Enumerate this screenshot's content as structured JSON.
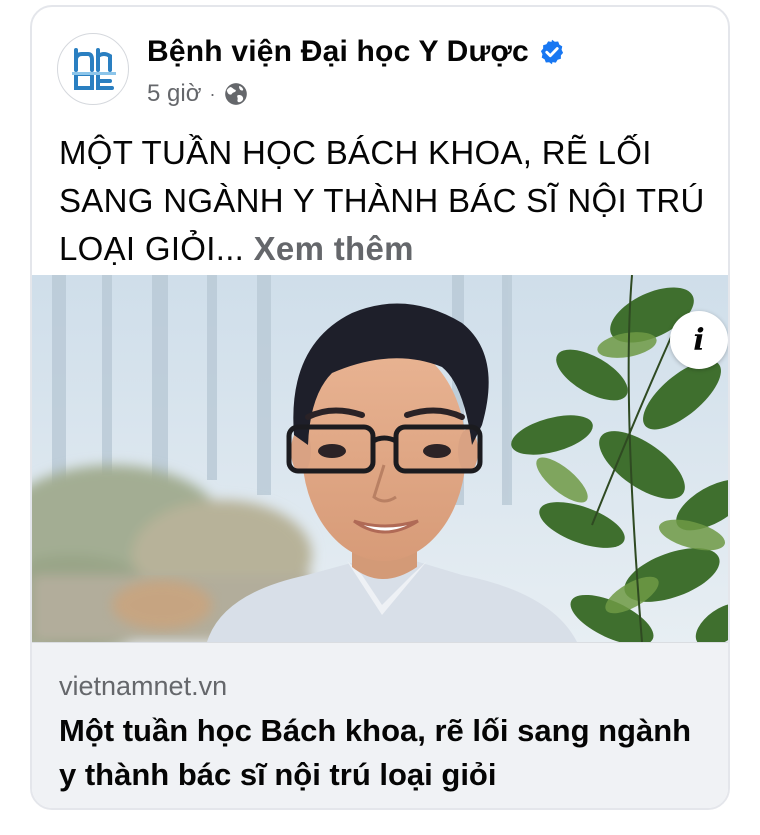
{
  "post": {
    "page_name": "Bệnh viện Đại học Y Dược",
    "time_ago": "5 giờ",
    "separator": "·",
    "text": "MỘT TUẦN HỌC BÁCH KHOA, RẼ LỐI SANG NGÀNH Y THÀNH BÁC SĨ NỘI TRÚ LOẠI GIỎI...",
    "see_more": "Xem thêm"
  },
  "link_preview": {
    "domain": "vietnamnet.vn",
    "title": "Một tuần học Bách khoa, rẽ lối sang ngành y thành bác sĩ nội trú loại giỏi"
  },
  "icons": {
    "verified": "verified-badge-icon",
    "audience": "globe-icon",
    "info": "info-icon",
    "avatar": "hospital-logo"
  },
  "colors": {
    "text_primary": "#050505",
    "text_secondary": "#65676b",
    "verified_blue": "#1877f2",
    "logo_blue": "#2a7fc1",
    "preview_bg": "#f0f2f5"
  }
}
